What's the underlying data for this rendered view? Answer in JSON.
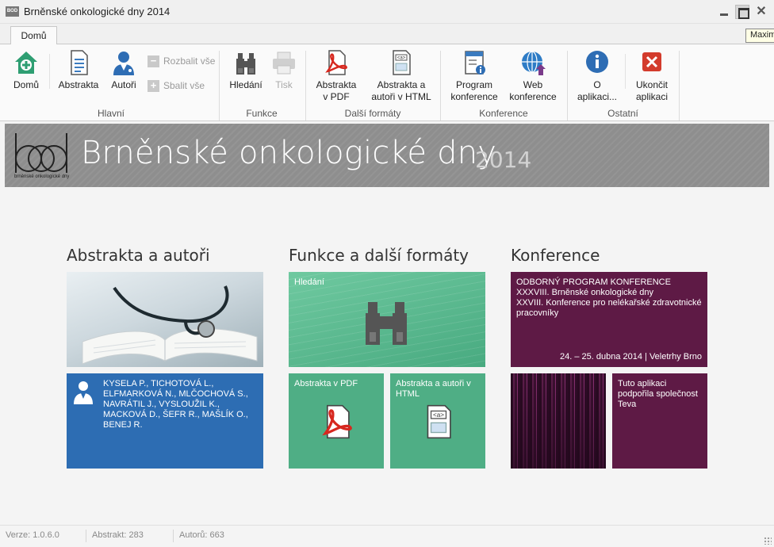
{
  "window": {
    "title": "Brněnské onkologické dny 2014",
    "app_icon_text": "BOD",
    "tooltip": "Maximize"
  },
  "tabs": [
    {
      "label": "Domů"
    }
  ],
  "ribbon": {
    "groups": {
      "hlavni": {
        "label": "Hlavní"
      },
      "funkce": {
        "label": "Funkce"
      },
      "formaty": {
        "label": "Další formáty"
      },
      "konference": {
        "label": "Konference"
      },
      "ostatni": {
        "label": "Ostatní"
      }
    },
    "buttons": {
      "domu": "Domů",
      "abstrakta": "Abstrakta",
      "autori": "Autoři",
      "rozbalit": "Rozbalit vše",
      "sbalit": "Sbalit vše",
      "hledani": "Hledání",
      "tisk": "Tisk",
      "abstrakta_pdf_1": "Abstrakta",
      "abstrakta_pdf_2": "v PDF",
      "abstrakta_html_1": "Abstrakta a",
      "abstrakta_html_2": "autoři v HTML",
      "program_1": "Program",
      "program_2": "konference",
      "web_1": "Web",
      "web_2": "konference",
      "about_1": "O",
      "about_2": "aplikaci...",
      "exit_1": "Ukončit",
      "exit_2": "aplikaci"
    },
    "html_icon_tag": "<a>"
  },
  "banner": {
    "title": "Brněnské onkologické dny",
    "year": "2014",
    "logo_tagline": "brněnské onkologické dny"
  },
  "sections": {
    "abstrakta": {
      "title": "Abstrakta a autoři",
      "authors": "KYSELA P., TICHOTOVÁ L., ELFMARKOVÁ N., MLČOCHOVÁ S., NAVRÁTIL J., VYSLOUŽIL K., MACKOVÁ D., ŠEFR R., MAŠLÍK O., BENEJ R."
    },
    "funkce": {
      "title": "Funkce a další formáty",
      "search_tile": "Hledání",
      "pdf_tile": "Abstrakta v PDF",
      "html_tile": "Abstrakta a autoři v HTML"
    },
    "konference": {
      "title": "Konference",
      "program_lines": [
        "ODBORNÝ PROGRAM KONFERENCE",
        "XXXVIII. Brněnské onkologické dny",
        "XXVIII. Konference pro nelékařské zdravotnické pracovníky"
      ],
      "program_date": "24. – 25. dubna 2014 | Veletrhy Brno",
      "teva_tile": "Tuto aplikaci podpořila společnost Teva"
    }
  },
  "status": {
    "version": "Verze: 1.0.6.0",
    "abstracts": "Abstrakt: 283",
    "authors": "Autorů: 663"
  },
  "colors": {
    "authors_tile": "#2d6db3",
    "green_tiles": "#4fae85",
    "conference_tiles": "#5e1a45",
    "banner": "#8e8e8e"
  },
  "icons": {
    "home": "home-plus-icon",
    "abstracts": "document-icon",
    "authors": "doctor-icon",
    "search": "binoculars-icon",
    "print": "printer-icon",
    "pdf": "pdf-icon",
    "html": "html-icon",
    "program": "program-icon",
    "web": "globe-icon",
    "about": "info-icon",
    "exit": "exit-icon"
  }
}
